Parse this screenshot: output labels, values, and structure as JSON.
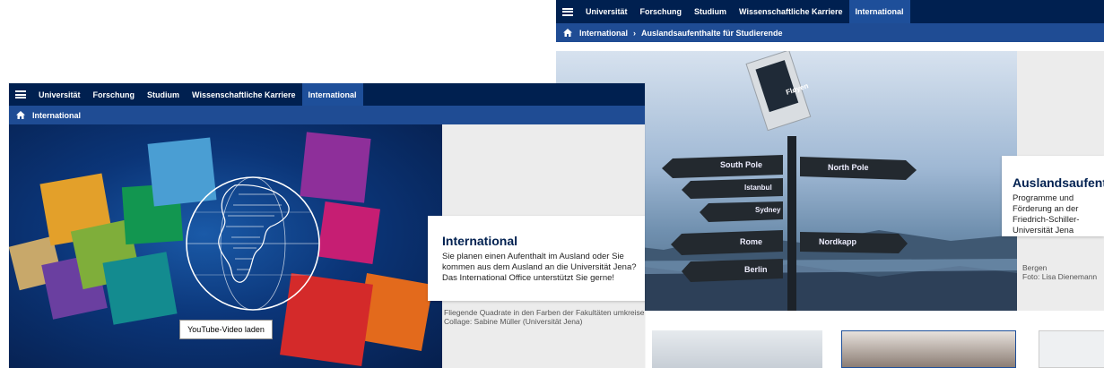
{
  "nav": {
    "items": [
      "Universität",
      "Forschung",
      "Studium",
      "Wissenschaftliche Karriere",
      "International"
    ],
    "active": "International"
  },
  "front": {
    "breadcrumb": [
      "International"
    ],
    "video_button": "YouTube-Video laden",
    "card": {
      "title": "International",
      "text": "Sie planen einen Aufenthalt im Ausland oder Sie kommen aus dem Ausland an die Universität Jena? Das International Office unterstützt Sie gerne!"
    },
    "caption": [
      "Fliegende Quadrate in den Farben der Fakultäten umkreisen",
      "Collage: Sabine Müller (Universität Jena)"
    ]
  },
  "back": {
    "breadcrumb": [
      "International",
      "Auslandsaufenthalte für Studierende"
    ],
    "signs": [
      "Fløyen",
      "South Pole",
      "North Pole",
      "Istanbul",
      "Sydney",
      "Rome",
      "Nordkapp",
      "Berlin"
    ],
    "card": {
      "title": "Auslandsaufenthalte",
      "text": "Programme und Förderung an der Friedrich-Schiller-Universität Jena"
    },
    "caption": [
      "Bergen",
      "Foto: Lisa Dienemann"
    ]
  },
  "colors": {
    "nav_bg": "#002050",
    "nav_active": "#1e4f9a",
    "breadcrumb_bg": "#1f4c94",
    "title": "#002050"
  }
}
